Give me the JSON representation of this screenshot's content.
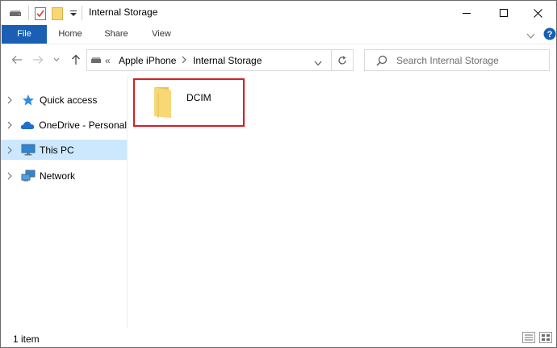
{
  "window": {
    "title": "Internal Storage"
  },
  "ribbon": {
    "tabs": [
      "File",
      "Home",
      "Share",
      "View"
    ]
  },
  "address": {
    "overflow": "«",
    "segments": [
      "Apple iPhone",
      "Internal Storage"
    ]
  },
  "search": {
    "placeholder": "Search Internal Storage"
  },
  "nav": {
    "items": [
      {
        "label": "Quick access",
        "icon": "star-icon"
      },
      {
        "label": "OneDrive - Personal",
        "icon": "cloud-icon"
      },
      {
        "label": "This PC",
        "icon": "monitor-icon"
      },
      {
        "label": "Network",
        "icon": "network-icon"
      }
    ]
  },
  "files": [
    {
      "name": "DCIM",
      "icon": "folder-icon"
    }
  ],
  "status": {
    "count_text": "1 item"
  },
  "colors": {
    "accent": "#1a5fb4",
    "selection": "#cce8ff",
    "highlight_border": "#d21f26",
    "folder": "#f8d775"
  }
}
